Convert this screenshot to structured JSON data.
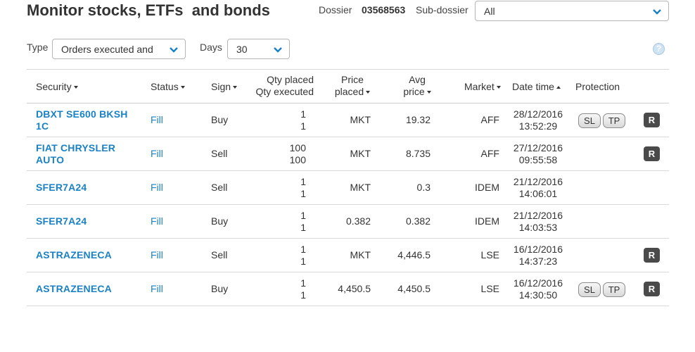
{
  "header": {
    "title": "Monitor stocks, ETFs  and bonds",
    "dossier_label": "Dossier",
    "dossier_value": "03568563",
    "subdossier_label": "Sub-dossier",
    "subdossier_value": "All"
  },
  "filters": {
    "type_label": "Type",
    "type_value": "Orders executed and",
    "days_label": "Days",
    "days_value": "30"
  },
  "help_icon": "?",
  "colors": {
    "link": "#1a82c4",
    "r_button": "#4a4a4a"
  },
  "columns": {
    "security": "Security",
    "status": "Status",
    "sign": "Sign",
    "qty_placed": "Qty placed",
    "qty_executed": "Qty executed",
    "price_line1": "Price",
    "price_line2": "placed",
    "avg_line1": "Avg",
    "avg_line2": "price",
    "market": "Market",
    "datetime": "Date time",
    "protection": "Protection"
  },
  "rows": [
    {
      "security_l1": "DBXT SE600 BKSH",
      "security_l2": "1C",
      "status": "Fill",
      "sign": "Buy",
      "qty_placed": "1",
      "qty_executed": "1",
      "price": "MKT",
      "avg": "19.32",
      "market": "AFF",
      "date": "28/12/2016",
      "time": "13:52:29",
      "sl": "SL",
      "tp": "TP",
      "r": "R"
    },
    {
      "security_l1": "FIAT CHRYSLER",
      "security_l2": "AUTO",
      "status": "Fill",
      "sign": "Sell",
      "qty_placed": "100",
      "qty_executed": "100",
      "price": "MKT",
      "avg": "8.735",
      "market": "AFF",
      "date": "27/12/2016",
      "time": "09:55:58",
      "r": "R"
    },
    {
      "security_l1": "SFER7A24",
      "security_l2": "",
      "status": "Fill",
      "sign": "Sell",
      "qty_placed": "1",
      "qty_executed": "1",
      "price": "MKT",
      "avg": "0.3",
      "market": "IDEM",
      "date": "21/12/2016",
      "time": "14:06:01"
    },
    {
      "security_l1": "SFER7A24",
      "security_l2": "",
      "status": "Fill",
      "sign": "Buy",
      "qty_placed": "1",
      "qty_executed": "1",
      "price": "0.382",
      "avg": "0.382",
      "market": "IDEM",
      "date": "21/12/2016",
      "time": "14:03:53"
    },
    {
      "security_l1": "ASTRAZENECA",
      "security_l2": "",
      "status": "Fill",
      "sign": "Sell",
      "qty_placed": "1",
      "qty_executed": "1",
      "price": "MKT",
      "avg": "4,446.5",
      "market": "LSE",
      "date": "16/12/2016",
      "time": "14:37:23",
      "r": "R"
    },
    {
      "security_l1": "ASTRAZENECA",
      "security_l2": "",
      "status": "Fill",
      "sign": "Buy",
      "qty_placed": "1",
      "qty_executed": "1",
      "price": "4,450.5",
      "avg": "4,450.5",
      "market": "LSE",
      "date": "16/12/2016",
      "time": "14:30:50",
      "sl": "SL",
      "tp": "TP",
      "r": "R"
    }
  ]
}
